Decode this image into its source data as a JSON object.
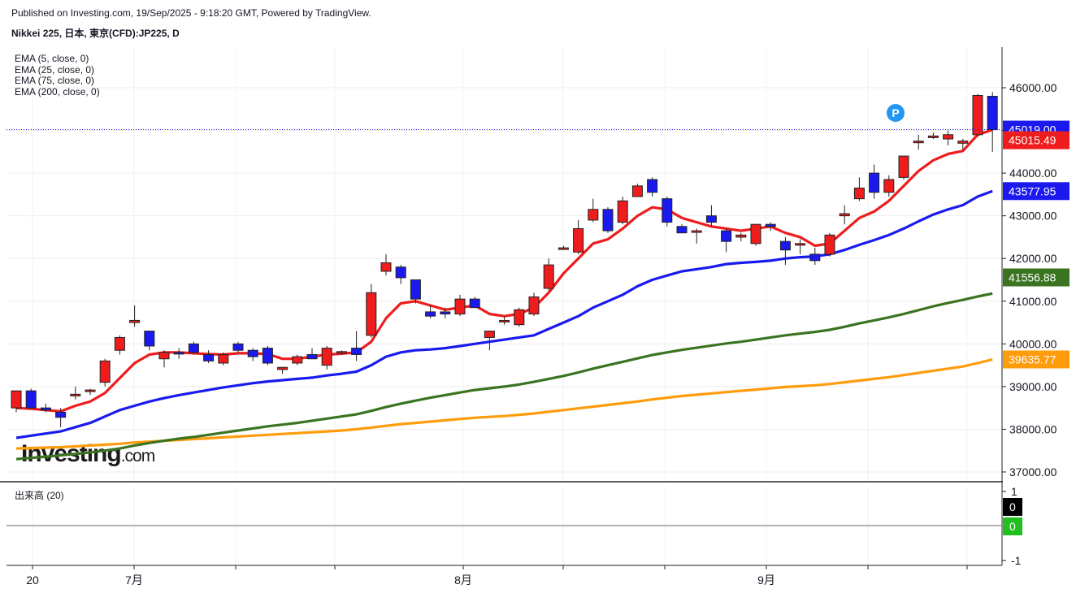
{
  "header": {
    "published": "Published on Investing.com, 19/Sep/2025 - 9:18:20 GMT, Powered by TradingView.",
    "symbol": "Nikkei 225, 日本, 東京(CFD):JP225, D"
  },
  "legend": [
    {
      "text": "EMA (5, close, 0)",
      "color": "#ee1c1c"
    },
    {
      "text": "EMA (25, close, 0)",
      "color": "#1a1aee"
    },
    {
      "text": "EMA (75, close, 0)",
      "color": "#3a7420"
    },
    {
      "text": "EMA (200, close, 0)",
      "color": "#ff9c0c"
    }
  ],
  "logo": {
    "brand": "Investing",
    "suffix": ".com"
  },
  "volume_pane": {
    "label": "出来高 (20)",
    "axis_ticks": [
      "1",
      "-1"
    ],
    "tags": [
      {
        "value": "0",
        "bg": "#000000"
      },
      {
        "value": "0",
        "bg": "#22c01f"
      }
    ]
  },
  "price_tags": [
    {
      "value": "45019.00",
      "bg": "#1a1aee",
      "price": 45019
    },
    {
      "value": "45015.49",
      "bg": "#ee1c1c",
      "price": 44770
    },
    {
      "value": "43577.95",
      "bg": "#1a1aee",
      "price": 43577.95
    },
    {
      "value": "41556.88",
      "bg": "#3a7420",
      "price": 41556.88
    },
    {
      "value": "39635.77",
      "bg": "#ff9c0c",
      "price": 39635.77
    }
  ],
  "colors": {
    "up": "#ee1c1c",
    "down": "#1a1aee",
    "ema5": "#ee1c1c",
    "ema25": "#1a1aee",
    "ema75": "#3a7420",
    "ema200": "#ff9c0c",
    "marker": "#2196f3"
  },
  "marker": {
    "label": "P"
  },
  "chart_data": {
    "type": "candlestick",
    "ylim": [
      36800,
      46800
    ],
    "y_ticks": [
      "37000.00",
      "38000.00",
      "39000.00",
      "40000.00",
      "41000.00",
      "42000.00",
      "43000.00",
      "44000.00",
      "45000.00",
      "46000.00"
    ],
    "x_ticks": [
      "20",
      "7月",
      "8月",
      "9月"
    ],
    "last_price_line": 45019,
    "candles": [
      {
        "o": 38500,
        "h": 38900,
        "l": 38400,
        "c": 38900
      },
      {
        "o": 38900,
        "h": 38950,
        "l": 38500,
        "c": 38500
      },
      {
        "o": 38500,
        "h": 38600,
        "l": 38400,
        "c": 38450
      },
      {
        "o": 38400,
        "h": 38500,
        "l": 38050,
        "c": 38280
      },
      {
        "o": 38800,
        "h": 39000,
        "l": 38700,
        "c": 38820
      },
      {
        "o": 38900,
        "h": 38950,
        "l": 38800,
        "c": 38920
      },
      {
        "o": 39100,
        "h": 39650,
        "l": 39000,
        "c": 39600
      },
      {
        "o": 39850,
        "h": 40200,
        "l": 39750,
        "c": 40150
      },
      {
        "o": 40500,
        "h": 40900,
        "l": 40400,
        "c": 40550
      },
      {
        "o": 40300,
        "h": 40300,
        "l": 39850,
        "c": 39950
      },
      {
        "o": 39650,
        "h": 39850,
        "l": 39450,
        "c": 39800
      },
      {
        "o": 39800,
        "h": 39900,
        "l": 39650,
        "c": 39780
      },
      {
        "o": 40000,
        "h": 40050,
        "l": 39750,
        "c": 39800
      },
      {
        "o": 39750,
        "h": 39850,
        "l": 39550,
        "c": 39600
      },
      {
        "o": 39550,
        "h": 39800,
        "l": 39500,
        "c": 39750
      },
      {
        "o": 40000,
        "h": 40050,
        "l": 39800,
        "c": 39850
      },
      {
        "o": 39850,
        "h": 39900,
        "l": 39600,
        "c": 39700
      },
      {
        "o": 39900,
        "h": 39950,
        "l": 39500,
        "c": 39550
      },
      {
        "o": 39400,
        "h": 39450,
        "l": 39300,
        "c": 39450
      },
      {
        "o": 39550,
        "h": 39750,
        "l": 39500,
        "c": 39700
      },
      {
        "o": 39750,
        "h": 39900,
        "l": 39650,
        "c": 39650
      },
      {
        "o": 39500,
        "h": 39950,
        "l": 39400,
        "c": 39900
      },
      {
        "o": 39800,
        "h": 39850,
        "l": 39750,
        "c": 39820
      },
      {
        "o": 39900,
        "h": 40300,
        "l": 39600,
        "c": 39750
      },
      {
        "o": 40200,
        "h": 41400,
        "l": 40150,
        "c": 41200
      },
      {
        "o": 41700,
        "h": 42100,
        "l": 41600,
        "c": 41900
      },
      {
        "o": 41800,
        "h": 41850,
        "l": 41400,
        "c": 41550
      },
      {
        "o": 41500,
        "h": 41500,
        "l": 40950,
        "c": 41050
      },
      {
        "o": 40750,
        "h": 40900,
        "l": 40600,
        "c": 40650
      },
      {
        "o": 40750,
        "h": 40850,
        "l": 40600,
        "c": 40700
      },
      {
        "o": 40700,
        "h": 41150,
        "l": 40650,
        "c": 41050
      },
      {
        "o": 41050,
        "h": 41100,
        "l": 40850,
        "c": 40850
      },
      {
        "o": 40150,
        "h": 40300,
        "l": 39850,
        "c": 40300
      },
      {
        "o": 40550,
        "h": 40650,
        "l": 40450,
        "c": 40550
      },
      {
        "o": 40450,
        "h": 40850,
        "l": 40400,
        "c": 40800
      },
      {
        "o": 40700,
        "h": 41200,
        "l": 40650,
        "c": 41100
      },
      {
        "o": 41300,
        "h": 42000,
        "l": 41250,
        "c": 41850
      },
      {
        "o": 42250,
        "h": 42300,
        "l": 42200,
        "c": 42250
      },
      {
        "o": 42150,
        "h": 42900,
        "l": 42100,
        "c": 42700
      },
      {
        "o": 42900,
        "h": 43400,
        "l": 42850,
        "c": 43150
      },
      {
        "o": 43150,
        "h": 43200,
        "l": 42600,
        "c": 42650
      },
      {
        "o": 42850,
        "h": 43450,
        "l": 42800,
        "c": 43350
      },
      {
        "o": 43450,
        "h": 43750,
        "l": 43450,
        "c": 43700
      },
      {
        "o": 43850,
        "h": 43900,
        "l": 43450,
        "c": 43550
      },
      {
        "o": 43400,
        "h": 43450,
        "l": 42750,
        "c": 42850
      },
      {
        "o": 42750,
        "h": 42800,
        "l": 42600,
        "c": 42600
      },
      {
        "o": 42650,
        "h": 42700,
        "l": 42350,
        "c": 42650
      },
      {
        "o": 43000,
        "h": 43250,
        "l": 42750,
        "c": 42850
      },
      {
        "o": 42650,
        "h": 42700,
        "l": 42150,
        "c": 42400
      },
      {
        "o": 42500,
        "h": 42600,
        "l": 42400,
        "c": 42550
      },
      {
        "o": 42350,
        "h": 42800,
        "l": 42300,
        "c": 42800
      },
      {
        "o": 42800,
        "h": 42850,
        "l": 42650,
        "c": 42750
      },
      {
        "o": 42400,
        "h": 42500,
        "l": 41850,
        "c": 42200
      },
      {
        "o": 42350,
        "h": 42450,
        "l": 42100,
        "c": 42350
      },
      {
        "o": 42100,
        "h": 42250,
        "l": 41850,
        "c": 41950
      },
      {
        "o": 42100,
        "h": 42600,
        "l": 42050,
        "c": 42550
      },
      {
        "o": 43000,
        "h": 43250,
        "l": 42800,
        "c": 43050
      },
      {
        "o": 43400,
        "h": 43900,
        "l": 43350,
        "c": 43650
      },
      {
        "o": 44000,
        "h": 44200,
        "l": 43400,
        "c": 43550
      },
      {
        "o": 43550,
        "h": 43950,
        "l": 43450,
        "c": 43850
      },
      {
        "o": 43900,
        "h": 44400,
        "l": 43850,
        "c": 44400
      },
      {
        "o": 44720,
        "h": 44900,
        "l": 44550,
        "c": 44750
      },
      {
        "o": 44850,
        "h": 44950,
        "l": 44800,
        "c": 44870
      },
      {
        "o": 44800,
        "h": 45000,
        "l": 44650,
        "c": 44900
      },
      {
        "o": 44700,
        "h": 44800,
        "l": 44550,
        "c": 44750
      },
      {
        "o": 44900,
        "h": 45850,
        "l": 44850,
        "c": 45820
      },
      {
        "o": 45800,
        "h": 45900,
        "l": 44500,
        "c": 45019
      }
    ],
    "ema5": [
      38500,
      38480,
      38450,
      38420,
      38550,
      38650,
      38850,
      39200,
      39550,
      39750,
      39800,
      39800,
      39780,
      39760,
      39750,
      39780,
      39780,
      39760,
      39650,
      39650,
      39700,
      39750,
      39770,
      39800,
      40050,
      40600,
      40950,
      41000,
      40900,
      40800,
      40850,
      40900,
      40700,
      40650,
      40700,
      40850,
      41200,
      41650,
      42000,
      42350,
      42450,
      42700,
      43000,
      43200,
      43150,
      42950,
      42850,
      42750,
      42700,
      42650,
      42700,
      42750,
      42600,
      42500,
      42300,
      42350,
      42650,
      42950,
      43100,
      43350,
      43700,
      44050,
      44300,
      44450,
      44520,
      44900,
      45015
    ],
    "ema25": [
      37800,
      37850,
      37900,
      37950,
      38050,
      38150,
      38300,
      38450,
      38550,
      38650,
      38730,
      38800,
      38860,
      38920,
      38980,
      39030,
      39080,
      39120,
      39150,
      39180,
      39210,
      39260,
      39300,
      39350,
      39500,
      39700,
      39800,
      39850,
      39870,
      39900,
      39950,
      40000,
      40050,
      40100,
      40150,
      40200,
      40350,
      40500,
      40650,
      40850,
      41000,
      41150,
      41350,
      41500,
      41600,
      41700,
      41750,
      41800,
      41870,
      41900,
      41920,
      41950,
      42000,
      42030,
      42050,
      42100,
      42200,
      42320,
      42430,
      42550,
      42700,
      42870,
      43030,
      43150,
      43250,
      43450,
      43578
    ],
    "ema75": [
      37300,
      37330,
      37360,
      37390,
      37420,
      37460,
      37500,
      37550,
      37620,
      37680,
      37730,
      37780,
      37820,
      37870,
      37920,
      37970,
      38020,
      38070,
      38110,
      38150,
      38200,
      38250,
      38300,
      38350,
      38430,
      38520,
      38600,
      38670,
      38740,
      38800,
      38860,
      38920,
      38960,
      39000,
      39050,
      39110,
      39180,
      39250,
      39330,
      39420,
      39500,
      39580,
      39660,
      39740,
      39800,
      39860,
      39910,
      39960,
      40010,
      40050,
      40100,
      40150,
      40200,
      40240,
      40280,
      40330,
      40400,
      40480,
      40550,
      40620,
      40700,
      40790,
      40880,
      40960,
      41030,
      41110,
      41180
    ],
    "ema200": [
      37550,
      37560,
      37570,
      37580,
      37600,
      37620,
      37640,
      37660,
      37690,
      37710,
      37730,
      37750,
      37770,
      37790,
      37810,
      37830,
      37850,
      37870,
      37890,
      37910,
      37930,
      37950,
      37970,
      38000,
      38040,
      38080,
      38120,
      38150,
      38180,
      38210,
      38240,
      38270,
      38290,
      38310,
      38340,
      38370,
      38410,
      38450,
      38490,
      38530,
      38570,
      38610,
      38650,
      38700,
      38740,
      38780,
      38810,
      38840,
      38870,
      38900,
      38930,
      38960,
      38990,
      39010,
      39030,
      39060,
      39100,
      39140,
      39180,
      39220,
      39270,
      39320,
      39370,
      39420,
      39470,
      39550,
      39636
    ]
  }
}
